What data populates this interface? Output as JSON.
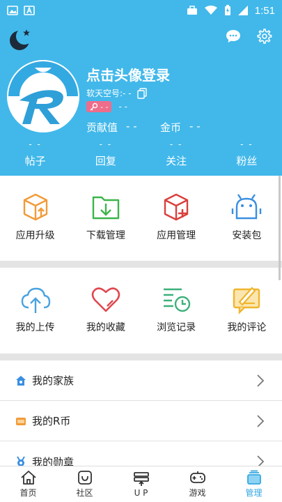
{
  "status_bar": {
    "time": "1:51"
  },
  "profile": {
    "login_prompt": "点击头像登录",
    "account_label": "软天空号:- -",
    "badge_value": "- -",
    "badge_extra": "- -",
    "contribution_label": "贡献值",
    "contribution_value": "- -",
    "coins_label": "金币",
    "coins_value": "- -"
  },
  "counts": [
    {
      "value": "- -",
      "label": "帖子"
    },
    {
      "value": "- -",
      "label": "回复"
    },
    {
      "value": "- -",
      "label": "关注"
    },
    {
      "value": "- -",
      "label": "粉丝"
    }
  ],
  "tools": [
    {
      "label": "应用升级",
      "icon": "upgrade-box-icon",
      "color": "#f29b38"
    },
    {
      "label": "下载管理",
      "icon": "download-folder-icon",
      "color": "#3cb54a"
    },
    {
      "label": "应用管理",
      "icon": "app-box-plus-icon",
      "color": "#d9403c"
    },
    {
      "label": "安装包",
      "icon": "android-package-icon",
      "color": "#3a8fe0"
    }
  ],
  "personal": [
    {
      "label": "我的上传",
      "icon": "cloud-upload-icon",
      "color": "#4aa3df"
    },
    {
      "label": "我的收藏",
      "icon": "heart-icon",
      "color": "#e0484f"
    },
    {
      "label": "浏览记录",
      "icon": "history-list-icon",
      "color": "#3cb07a"
    },
    {
      "label": "我的评论",
      "icon": "comment-pen-icon",
      "color": "#f0b52e"
    }
  ],
  "list": [
    {
      "label": "我的家族",
      "icon": "family-icon",
      "color": "#3a8fe0"
    },
    {
      "label": "我的R币",
      "icon": "coin-icon",
      "color": "#f29b38"
    },
    {
      "label": "我的勋章",
      "icon": "medal-icon",
      "color": "#3a8fe0"
    }
  ],
  "tabs": [
    {
      "label": "首页",
      "icon": "home-icon"
    },
    {
      "label": "社区",
      "icon": "community-icon"
    },
    {
      "label": "U P",
      "icon": "up-icon"
    },
    {
      "label": "游戏",
      "icon": "gamepad-icon"
    },
    {
      "label": "管理",
      "icon": "manage-icon",
      "active": true
    }
  ],
  "colors": {
    "brand": "#42b8ea",
    "tab_active": "#34a7e0"
  }
}
